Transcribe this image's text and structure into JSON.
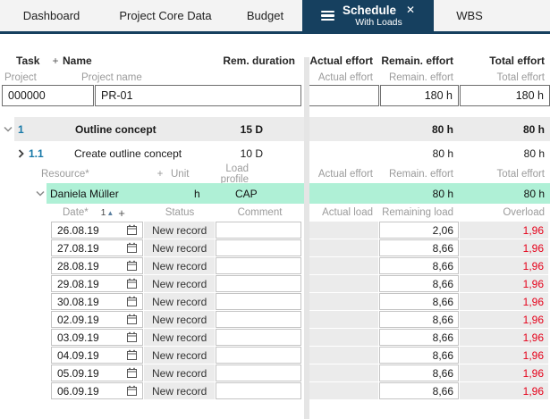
{
  "colors": {
    "tab_active_bg": "#16405f",
    "highlight_row": "#aff0d6",
    "alt_row_bg": "#ebebeb",
    "overload_text": "#e50019",
    "task_number_text": "#1879a8"
  },
  "tabbar": {
    "tabs": [
      {
        "label": "Dashboard"
      },
      {
        "label": "Project Core Data"
      },
      {
        "label": "Budget"
      },
      {
        "label": "Schedule",
        "sublabel": "With Loads",
        "close_glyph": "✕"
      },
      {
        "label": "WBS"
      }
    ]
  },
  "effort_table": {
    "header": {
      "task": "Task",
      "add": "+",
      "name": "Name",
      "rem_duration": "Rem. duration",
      "actual_effort": "Actual effort",
      "remain_effort": "Remain. effort",
      "total_effort": "Total effort"
    },
    "subheader": {
      "project": "Project",
      "project_name": "Project name",
      "actual_effort": "Actual effort",
      "remain_effort": "Remain. effort",
      "total_effort": "Total effort"
    },
    "project_row": {
      "id": "000000",
      "name": "PR-01",
      "actual_effort": "",
      "remain_effort": "180 h",
      "total_effort": "180 h"
    },
    "task_rows": [
      {
        "number": "1",
        "name": "Outline concept",
        "duration": "15 D",
        "actual_effort": "",
        "remain_effort": "80 h",
        "total_effort": "80 h"
      },
      {
        "number": "1.1",
        "name": "Create outline concept",
        "duration": "10 D",
        "actual_effort": "",
        "remain_effort": "80 h",
        "total_effort": "80 h"
      }
    ]
  },
  "resource_table": {
    "header": {
      "resource": "Resource*",
      "add": "+",
      "unit": "Unit",
      "load_profile": "Load profile",
      "actual_effort": "Actual effort",
      "remain_effort": "Remain. effort",
      "total_effort": "Total effort"
    },
    "row": {
      "name": "Daniela Müller",
      "unit": "h",
      "load_profile": "CAP",
      "actual_effort": "",
      "remain_effort": "80 h",
      "total_effort": "80 h"
    }
  },
  "load_table": {
    "header": {
      "date": "Date*",
      "sort_number": "1",
      "sort_arrow": "▲",
      "add": "+",
      "status": "Status",
      "comment": "Comment",
      "actual_load": "Actual load",
      "remaining_load": "Remaining load",
      "overload": "Overload"
    },
    "rows": [
      {
        "date": "26.08.19",
        "status": "New record",
        "comment": "",
        "actual_load": "",
        "remaining_load": "2,06",
        "overload": "1,96"
      },
      {
        "date": "27.08.19",
        "status": "New record",
        "comment": "",
        "actual_load": "",
        "remaining_load": "8,66",
        "overload": "1,96"
      },
      {
        "date": "28.08.19",
        "status": "New record",
        "comment": "",
        "actual_load": "",
        "remaining_load": "8,66",
        "overload": "1,96"
      },
      {
        "date": "29.08.19",
        "status": "New record",
        "comment": "",
        "actual_load": "",
        "remaining_load": "8,66",
        "overload": "1,96"
      },
      {
        "date": "30.08.19",
        "status": "New record",
        "comment": "",
        "actual_load": "",
        "remaining_load": "8,66",
        "overload": "1,96"
      },
      {
        "date": "02.09.19",
        "status": "New record",
        "comment": "",
        "actual_load": "",
        "remaining_load": "8,66",
        "overload": "1,96"
      },
      {
        "date": "03.09.19",
        "status": "New record",
        "comment": "",
        "actual_load": "",
        "remaining_load": "8,66",
        "overload": "1,96"
      },
      {
        "date": "04.09.19",
        "status": "New record",
        "comment": "",
        "actual_load": "",
        "remaining_load": "8,66",
        "overload": "1,96"
      },
      {
        "date": "05.09.19",
        "status": "New record",
        "comment": "",
        "actual_load": "",
        "remaining_load": "8,66",
        "overload": "1,96"
      },
      {
        "date": "06.09.19",
        "status": "New record",
        "comment": "",
        "actual_load": "",
        "remaining_load": "8,66",
        "overload": "1,96"
      }
    ]
  }
}
